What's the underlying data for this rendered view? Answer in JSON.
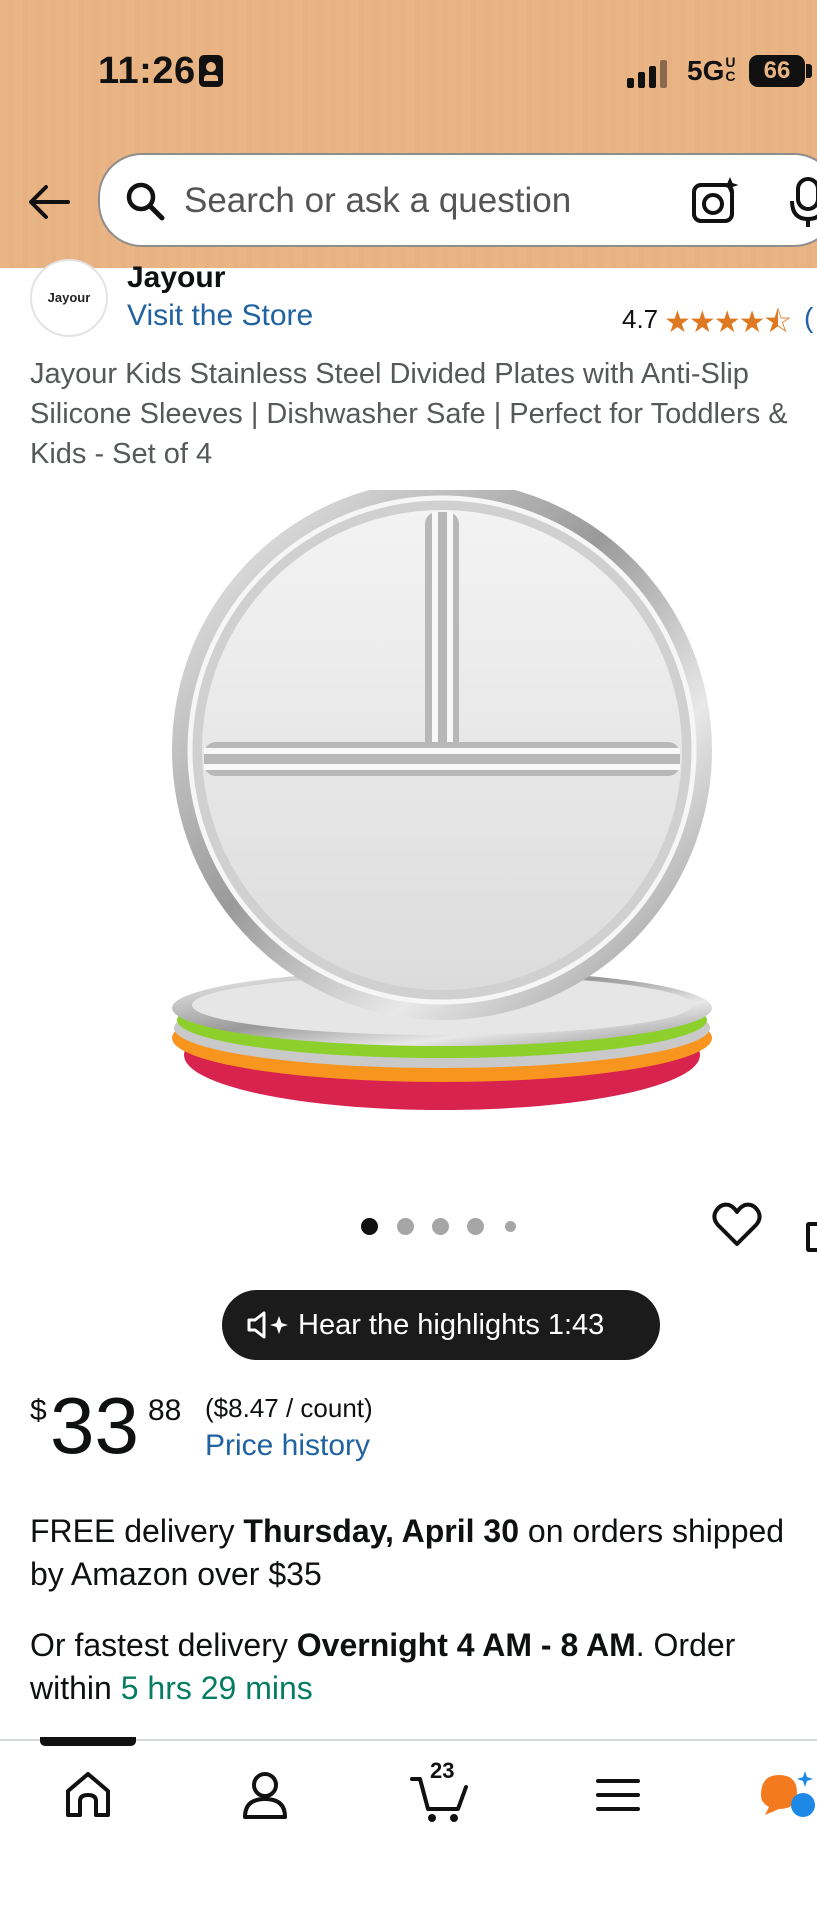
{
  "status_bar": {
    "time": "11:26",
    "network": "5G",
    "network_suffix": "UC",
    "battery": "66"
  },
  "search": {
    "placeholder": "Search or ask a question"
  },
  "brand": {
    "logo_text": "Jayour",
    "name": "Jayour",
    "visit_store": "Visit the Store",
    "rating": "4.7",
    "stars": "★★★★⯪",
    "rating_count_partial": "("
  },
  "product": {
    "title_lines": [
      "Jayour Kids Stainless Steel Divided Plates with Anti-Slip",
      "Silicone Sleeves | Dishwasher Safe | Perfect for Toddlers &",
      "Kids - Set of 4"
    ],
    "image_dots": 5,
    "active_dot": 0,
    "plate_colors": [
      "#d8234f",
      "#f7951e",
      "#8dd02c"
    ]
  },
  "highlights": {
    "label": "Hear the highlights 1:43"
  },
  "price": {
    "symbol": "$",
    "whole": "33",
    "fraction": "88",
    "per_count": "($8.47 / count)",
    "history_link": "Price history"
  },
  "delivery": {
    "line1_prefix": "FREE delivery ",
    "line1_bold": "Thursday, April 30",
    "line1_suffix": " on orders shipped",
    "line2": "by Amazon over $35",
    "fast_prefix": "Or fastest delivery ",
    "fast_bold": "Overnight 4 AM - 8 AM",
    "fast_suffix": ". Order",
    "within_prefix": "within ",
    "within_time": "5 hrs 29 mins"
  },
  "bottom_nav": {
    "items": [
      "home-icon",
      "account-icon",
      "cart-icon",
      "menu-icon",
      "rufus-icon"
    ],
    "cart_count": "23"
  },
  "colors": {
    "header_bg": "#eab585",
    "link": "#2162a1",
    "star": "#de7921",
    "teal": "#067d62"
  }
}
